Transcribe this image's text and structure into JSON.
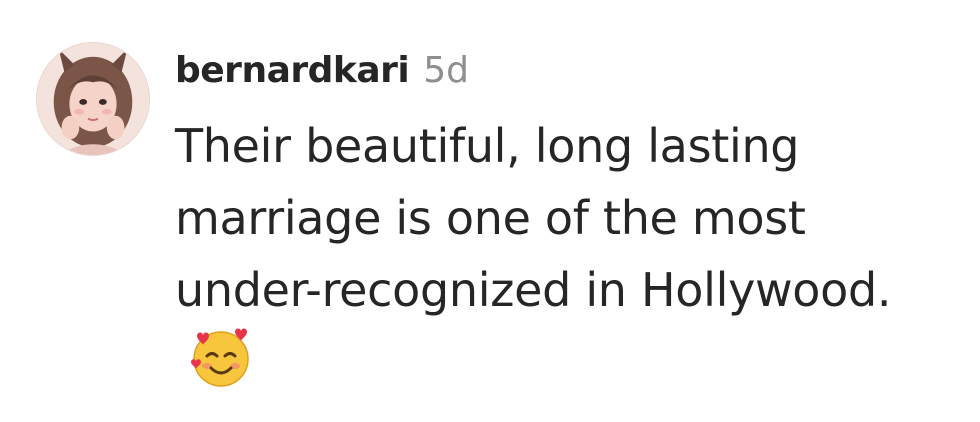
{
  "comment": {
    "username": "bernardkari",
    "timestamp": "5d",
    "text": "Their beautiful, long lasting marriage is one of the most under-recognized in Hollywood.",
    "emoji_icon": "smiling-face-with-hearts-icon",
    "avatar_icon": "user-avatar-icon"
  },
  "colors": {
    "username": "#262626",
    "timestamp": "#8e8e8e",
    "text": "#262626",
    "background": "#ffffff"
  }
}
